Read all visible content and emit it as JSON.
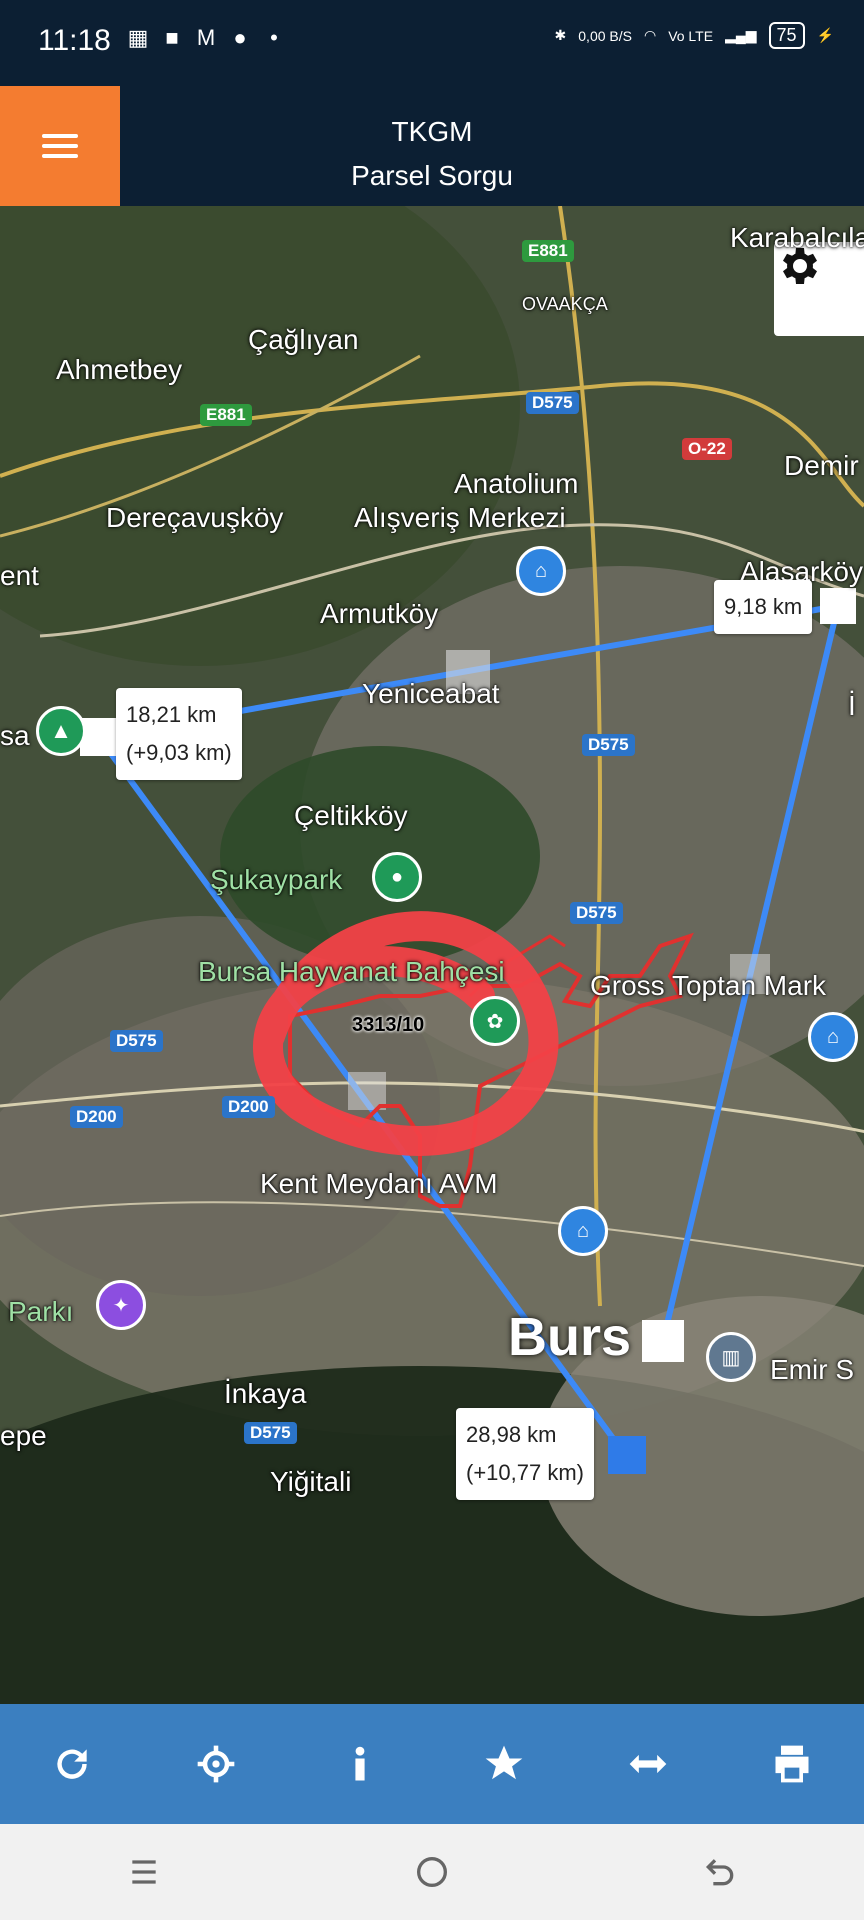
{
  "status_bar": {
    "time": "11:18",
    "data_rate": "0,00 B/S",
    "network": "Vo LTE",
    "battery": "75"
  },
  "app": {
    "title": "TKGM",
    "subtitle": "Parsel Sorgu"
  },
  "map": {
    "places": [
      "Karabalcılar",
      "Çağlıyan",
      "Ahmetbey",
      "OVAAKÇA",
      "Demir",
      "Anatolium",
      "Alışveriş Merkezi",
      "Dereçavuşköy",
      "ent",
      "Alaşarköy",
      "Armutköy",
      "Yeniceabat",
      "Çeltikköy",
      "Şukaypark",
      "Bursa Hayvanat Bahçesi",
      "Gross Toptan Mark",
      "Kent Meydanı AVM",
      "Parkı",
      "İnkaya",
      "Yiğitali",
      "Emir S",
      "epe",
      "sa",
      "İ"
    ],
    "roads": [
      "E881",
      "E881",
      "D575",
      "O-22",
      "D575",
      "D575",
      "D575",
      "D200",
      "D200",
      "D575"
    ],
    "city_label": "Burs",
    "parcel_label": "3313/10",
    "measurements": [
      {
        "line1": "9,18 km",
        "line2": ""
      },
      {
        "line1": "18,21 km",
        "line2": "(+9,03 km)"
      },
      {
        "line1": "28,98 km",
        "line2": "(+10,77 km)"
      }
    ],
    "colors": {
      "measure_line": "#3d8af7",
      "parcel": "#e0312f",
      "annotation": "#f24147"
    }
  },
  "toolbar": {
    "icons": [
      "refresh-icon",
      "locate-icon",
      "info-icon",
      "star-icon",
      "measure-icon",
      "print-icon"
    ]
  },
  "navbar": {
    "icons": [
      "recents-icon",
      "home-icon",
      "back-icon"
    ]
  }
}
